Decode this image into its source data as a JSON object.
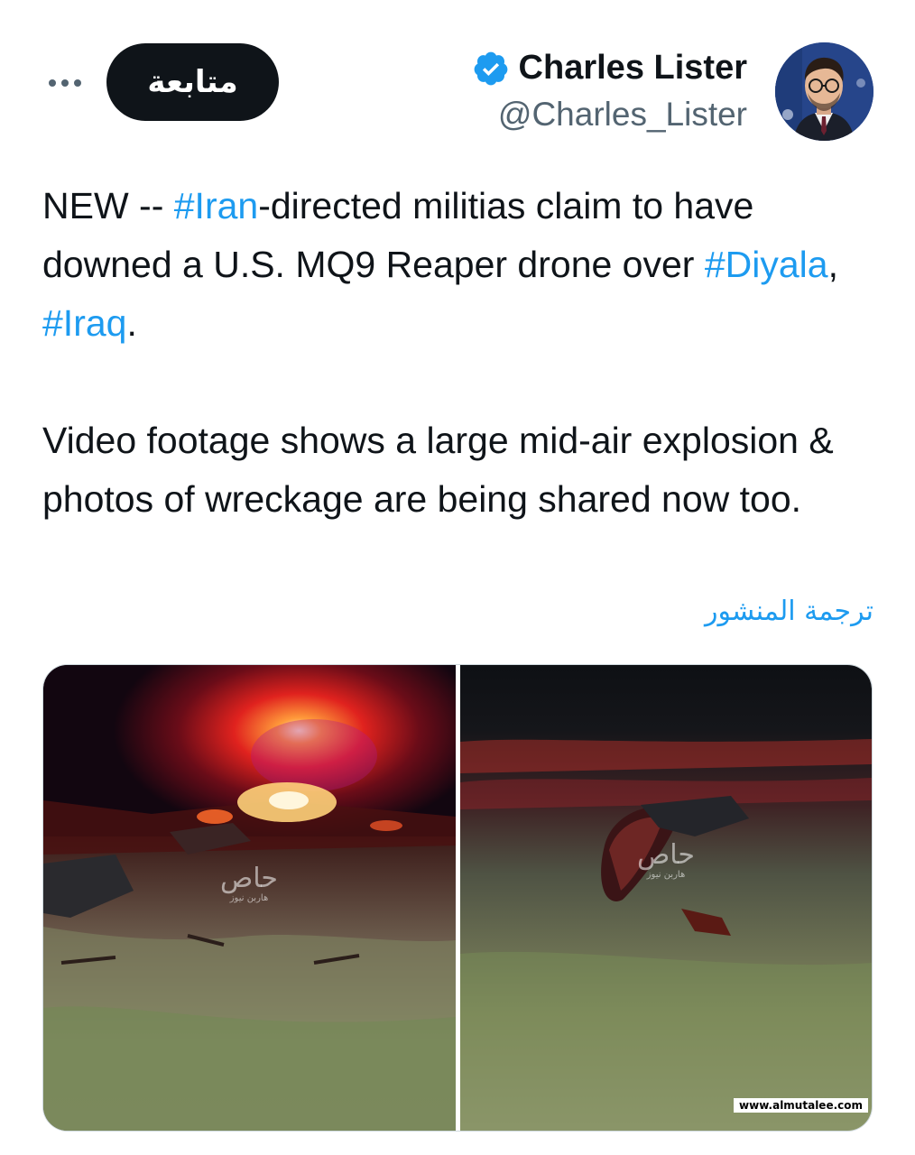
{
  "header": {
    "follow_label": "متابعة",
    "display_name": "Charles Lister",
    "handle": "@Charles_Lister",
    "more_icon": "more-horizontal-icon",
    "verified_icon": "verified-badge-icon",
    "verified_color": "#1d9bf0"
  },
  "tweet": {
    "p1_a": "NEW -- ",
    "p1_tag1": "#Iran",
    "p1_b": "-directed militias claim to have downed a U.S. MQ9 Reaper drone over ",
    "p1_tag2": "#Diyala",
    "p1_c": ", ",
    "p1_tag3": "#Iraq",
    "p1_d": ".",
    "p2": "Video footage shows a large mid-air explosion & photos of wreckage are being shared now too.",
    "hashtag_color": "#1d9bf0"
  },
  "translate_label": "ترجمة المنشور",
  "media": {
    "photo_watermark_big": "حاص",
    "photo_watermark_small": "هاربن نيوز"
  },
  "site_watermark": "www.almutalee.com"
}
